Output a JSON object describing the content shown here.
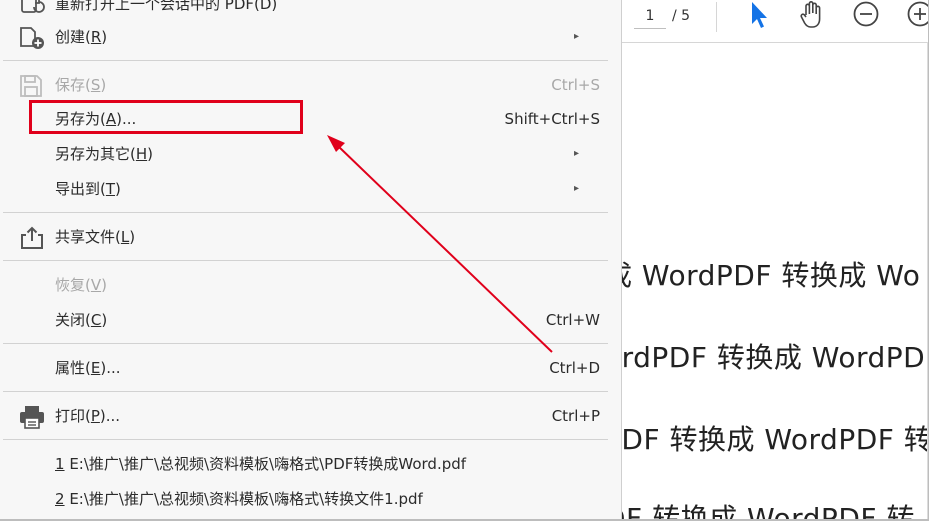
{
  "menu": {
    "items": [
      {
        "label": "重新打开上一个会话中的 PDF(D)",
        "icon": "reopen-icon"
      },
      {
        "label": "创建(",
        "key": "R",
        "suffix": ")",
        "submenu": true,
        "icon": "create-icon"
      },
      {
        "label": "保存(",
        "key": "S",
        "suffix": ")",
        "shortcut": "Ctrl+S",
        "disabled": true,
        "icon": "save-icon"
      },
      {
        "label": "另存为(",
        "key": "A",
        "suffix": ")...",
        "shortcut": "Shift+Ctrl+S"
      },
      {
        "label": "另存为其它(",
        "key": "H",
        "suffix": ")",
        "submenu": true
      },
      {
        "label": "导出到(",
        "key": "T",
        "suffix": ")",
        "submenu": true
      },
      {
        "label": "共享文件(",
        "key": "L",
        "suffix": ")",
        "icon": "share-icon"
      },
      {
        "label": "恢复(",
        "key": "V",
        "suffix": ")",
        "disabled": true
      },
      {
        "label": "关闭(",
        "key": "C",
        "suffix": ")",
        "shortcut": "Ctrl+W"
      },
      {
        "label": "属性(",
        "key": "E",
        "suffix": ")...",
        "shortcut": "Ctrl+D"
      },
      {
        "label": "打印(",
        "key": "P",
        "suffix": ")...",
        "shortcut": "Ctrl+P",
        "icon": "print-icon"
      }
    ],
    "recent_files": [
      {
        "num": "1",
        "path": " E:\\推广\\推广\\总视频\\资料模板\\嗨格式\\PDF转换成Word.pdf"
      },
      {
        "num": "2",
        "path": " E:\\推广\\推广\\总视频\\资料模板\\嗨格式\\转换文件1.pdf"
      }
    ],
    "submenu_glyph": "▸"
  },
  "toolbar": {
    "page_current": "1",
    "page_total": "/ 5",
    "tools": [
      "select-cursor-icon",
      "hand-tool-icon",
      "zoom-out-icon",
      "zoom-in-icon"
    ]
  },
  "document": {
    "lines": [
      "成 WordPDF 转换成 Wo",
      "ordPDF 转换成 WordPD",
      "PDF 转换成 WordPDF 转",
      "DF 转换成 WordPDF 转"
    ]
  },
  "colors": {
    "annotation": "#e0001b",
    "accent": "#1473e6",
    "menu_bg": "#f7f7f7"
  }
}
